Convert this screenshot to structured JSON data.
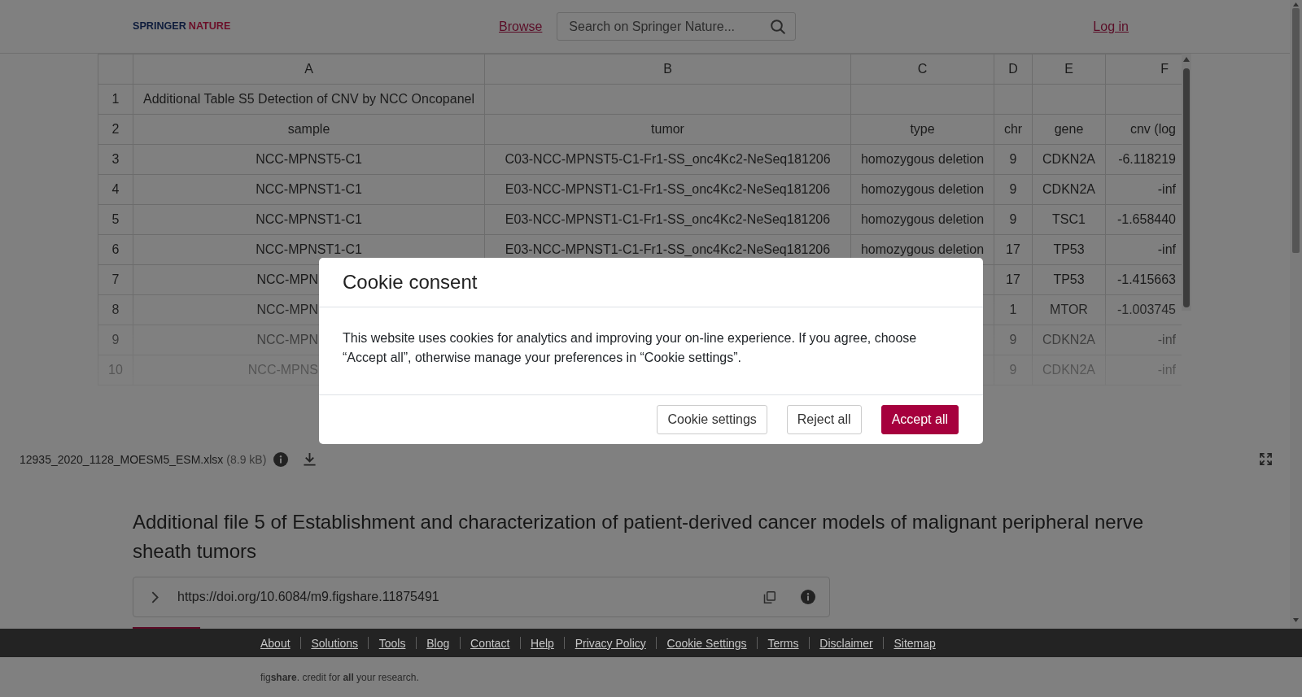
{
  "header": {
    "logo": [
      "SPRINGER",
      "NATURE"
    ],
    "browse_link": "Browse",
    "search": {
      "placeholder": "Search on Springer Nature..."
    },
    "login_link": "Log in"
  },
  "spreadsheet": {
    "columns": [
      "A",
      "B",
      "C",
      "D",
      "E",
      "F"
    ],
    "rows": [
      {
        "number": "1",
        "covered_by_dialog": false,
        "cells": {
          "A": "Additional Table S5 Detection of CNV by NCC Oncopanel"
        }
      },
      {
        "number": "2",
        "covered_by_dialog": false,
        "cells": {
          "A": "sample",
          "B": "tumor",
          "C": "type",
          "D": "chr",
          "E": "gene",
          "F": "cnv (log"
        }
      },
      {
        "number": "3",
        "covered_by_dialog": false,
        "cells": {
          "A": "NCC-MPNST5-C1",
          "B": "C03-NCC-MPNST5-C1-Fr1-SS_onc4Kc2-NeSeq181206",
          "C": "homozygous deletion",
          "D": "9",
          "E": "CDKN2A",
          "F": "-6.118219"
        }
      },
      {
        "number": "4",
        "covered_by_dialog": false,
        "cells": {
          "A": "NCC-MPNST1-C1",
          "B": "E03-NCC-MPNST1-C1-Fr1-SS_onc4Kc2-NeSeq181206",
          "C": "homozygous deletion",
          "D": "9",
          "E": "CDKN2A",
          "F": "-inf"
        }
      },
      {
        "number": "5",
        "covered_by_dialog": false,
        "cells": {
          "A": "NCC-MPNST1-C1",
          "B": "E03-NCC-MPNST1-C1-Fr1-SS_onc4Kc2-NeSeq181206",
          "C": "homozygous deletion",
          "D": "9",
          "E": "TSC1",
          "F": "-1.658440"
        }
      },
      {
        "number": "6",
        "covered_by_dialog": false,
        "cells": {
          "A": "NCC-MPNST1-C1",
          "B": "E03-NCC-MPNST1-C1-Fr1-SS_onc4Kc2-NeSeq181206",
          "C": "homozygous deletion",
          "D": "17",
          "E": "TP53",
          "F": "-inf"
        }
      },
      {
        "number": "7",
        "covered_by_dialog": true,
        "cells": {
          "A": "NCC-MPN",
          "D": "17",
          "E": "TP53",
          "F": "-1.415663"
        }
      },
      {
        "number": "8",
        "covered_by_dialog": true,
        "cells": {
          "A": "NCC-MPN",
          "D": "1",
          "E": "MTOR",
          "F": "-1.003745"
        }
      },
      {
        "number": "9",
        "covered_by_dialog": true,
        "cells": {
          "A": "NCC-MPN",
          "D": "9",
          "E": "CDKN2A",
          "F": "-inf"
        }
      },
      {
        "number": "10",
        "covered_by_dialog": true,
        "cells": {
          "A": "NCC-MPNS",
          "D": "9",
          "E": "CDKN2A",
          "F": "-inf"
        }
      }
    ]
  },
  "file": {
    "name": "12935_2020_1128_MOESM5_ESM.xlsx",
    "size": "(8.9 kB)"
  },
  "item": {
    "title": "Additional file 5 of Establishment and characterization of patient-derived cancer models of malignant peripheral nerve sheath tumors",
    "doi": "https://doi.org/10.6084/m9.figshare.11875491"
  },
  "footer": {
    "links": [
      "About",
      "Solutions",
      "Tools",
      "Blog",
      "Contact",
      "Help",
      "Privacy Policy",
      "Cookie Settings",
      "Terms",
      "Disclaimer",
      "Sitemap"
    ],
    "tagline": "fig**share**. credit for **all** your research."
  },
  "cookie_dialog": {
    "title": "Cookie consent",
    "text": "This website uses cookies for analytics and improving your on-line experience. If you agree, choose “Accept all”, otherwise manage your preferences in “Cookie settings”.",
    "buttons": [
      {
        "label": "Cookie settings",
        "kind": "secondary"
      },
      {
        "label": "Reject all",
        "kind": "secondary"
      },
      {
        "label": "Accept all",
        "kind": "primary"
      }
    ]
  }
}
